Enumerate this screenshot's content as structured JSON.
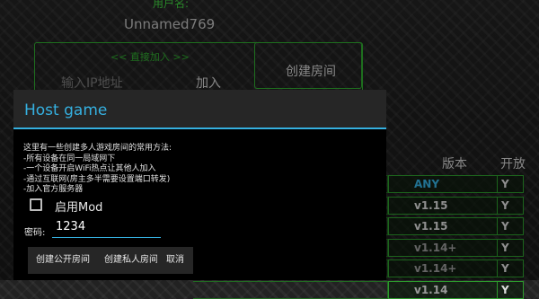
{
  "background": {
    "username_label": "用户名:",
    "username": "Unnamed769",
    "join_title": "<< 直接加入 >>",
    "ip_placeholder": "输入IP地址",
    "join_button": "加入",
    "create_room_button": "创建房间",
    "column_version": "版本",
    "column_open": "开放",
    "rows": [
      {
        "version": "ANY",
        "version_color": "#35b0e0",
        "open": "Y"
      },
      {
        "version": "v1.15",
        "version_color": "#dcdcdc",
        "open": "Y"
      },
      {
        "version": "v1.15",
        "version_color": "#dcdcdc",
        "open": "Y"
      },
      {
        "version": "v1.14+",
        "version_color": "#9a9a9a",
        "open": "Y"
      },
      {
        "version": "v1.14+",
        "version_color": "#9a9a9a",
        "open": "Y"
      },
      {
        "version": "v1.14",
        "version_color": "#9a9a9a",
        "open": "Y"
      }
    ]
  },
  "dialog": {
    "title": "Host game",
    "description": [
      "这里有一些创建多人游戏房间的常用方法:",
      "-所有设备在同一局域网下",
      "-一个设备开启WiFi热点让其他人加入",
      "-通过互联网(房主多半需要设置端口转发)",
      "-加入官方服务器"
    ],
    "enable_mod_label": "启用Mod",
    "enable_mod_checked": false,
    "password_label": "密码:",
    "password_value": "1234",
    "buttons": {
      "public": "创建公开房间",
      "private": "创建私人房间",
      "cancel": "取消"
    }
  },
  "colors": {
    "accent": "#35b0e0",
    "frame_green": "#2faa2f"
  }
}
